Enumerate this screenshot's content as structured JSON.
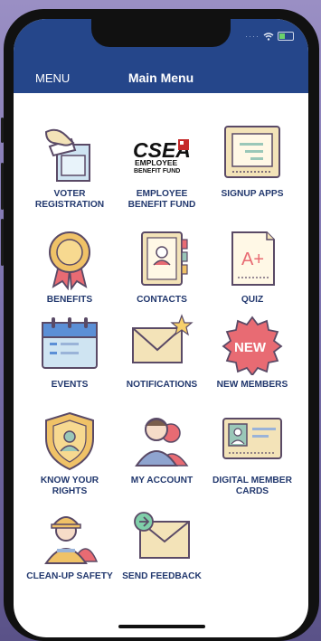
{
  "header": {
    "menu_label": "MENU",
    "title": "Main Menu"
  },
  "tiles": [
    {
      "label": "VOTER REGISTRATION",
      "icon": "ballot-box-icon"
    },
    {
      "label": "EMPLOYEE BENEFIT FUND",
      "icon": "csea-logo"
    },
    {
      "label": "SIGNUP APPS",
      "icon": "form-icon"
    },
    {
      "label": "BENEFITS",
      "icon": "award-badge-icon"
    },
    {
      "label": "CONTACTS",
      "icon": "contact-book-icon"
    },
    {
      "label": "QUIZ",
      "icon": "a-plus-paper-icon"
    },
    {
      "label": "EVENTS",
      "icon": "calendar-icon"
    },
    {
      "label": "NOTIFICATIONS",
      "icon": "envelope-star-icon"
    },
    {
      "label": "NEW MEMBERS",
      "icon": "new-badge-icon"
    },
    {
      "label": "KNOW YOUR RIGHTS",
      "icon": "shield-person-icon"
    },
    {
      "label": "MY ACCOUNT",
      "icon": "user-group-icon"
    },
    {
      "label": "DIGITAL MEMBER CARDS",
      "icon": "id-card-icon"
    },
    {
      "label": "CLEAN-UP SAFETY",
      "icon": "worker-helmet-icon"
    },
    {
      "label": "SEND FEEDBACK",
      "icon": "envelope-send-icon"
    }
  ],
  "logo_text": {
    "line1": "CSEA",
    "line2": "EMPLOYEE",
    "line3": "BENEFIT FUND"
  },
  "quiz_grade": "A+",
  "new_badge_text": "NEW",
  "colors": {
    "header": "#25468a",
    "label": "#22386e",
    "icon_outline": "#5a4a66",
    "beige": "#f3e3b8",
    "coral": "#e86b73"
  }
}
